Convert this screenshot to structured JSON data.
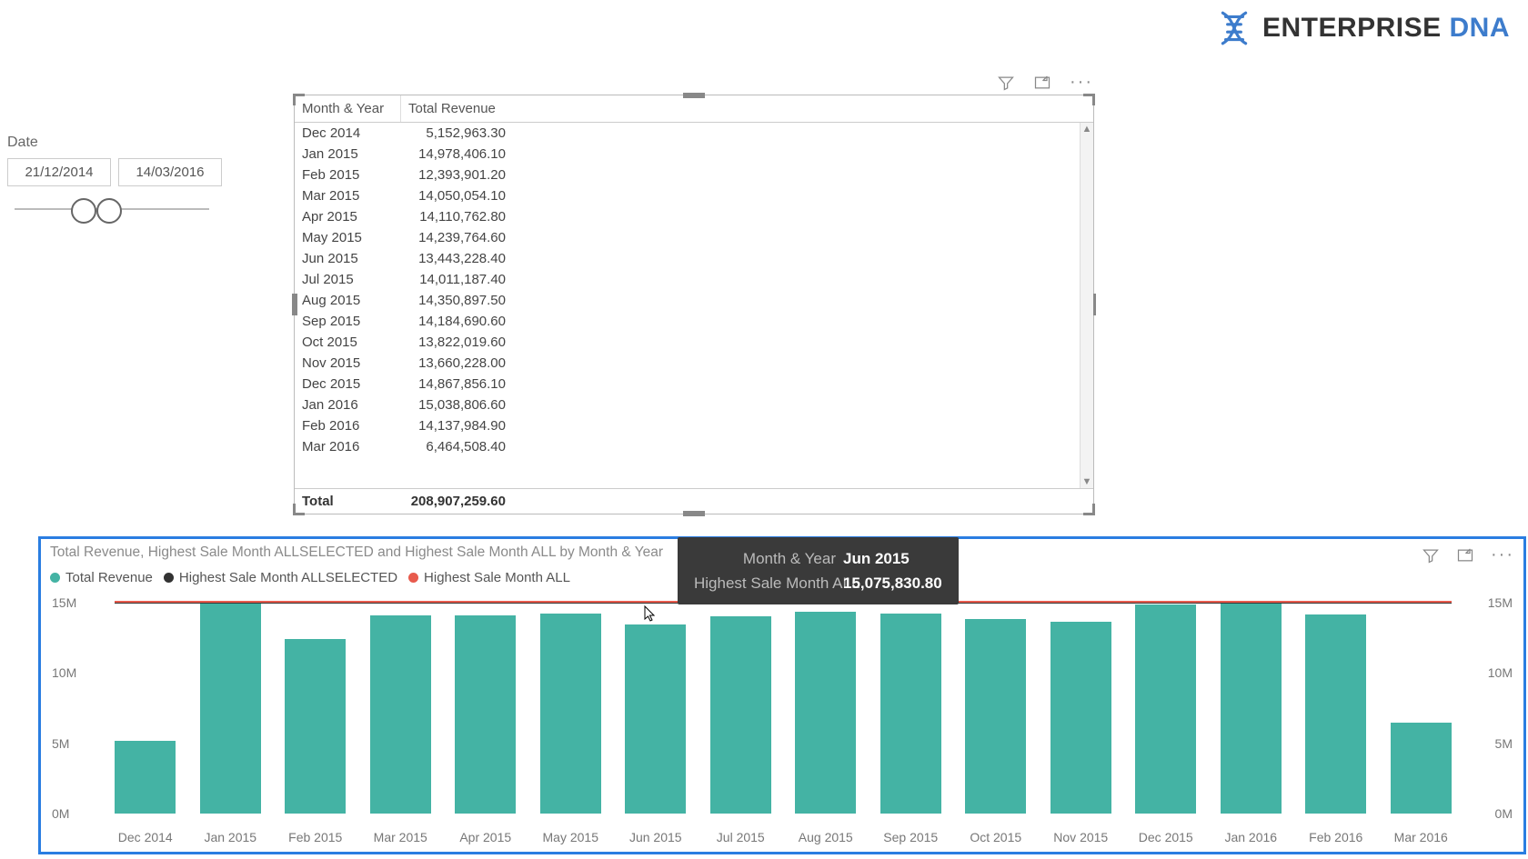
{
  "brand": {
    "name1": "ENTERPRISE",
    "name2": "DNA"
  },
  "slicer": {
    "title": "Date",
    "from": "21/12/2014",
    "to": "14/03/2016"
  },
  "table": {
    "headers": {
      "c1": "Month & Year",
      "c2": "Total Revenue"
    },
    "rows": [
      {
        "c1": "Dec 2014",
        "c2": "5,152,963.30"
      },
      {
        "c1": "Jan 2015",
        "c2": "14,978,406.10"
      },
      {
        "c1": "Feb 2015",
        "c2": "12,393,901.20"
      },
      {
        "c1": "Mar 2015",
        "c2": "14,050,054.10"
      },
      {
        "c1": "Apr 2015",
        "c2": "14,110,762.80"
      },
      {
        "c1": "May 2015",
        "c2": "14,239,764.60"
      },
      {
        "c1": "Jun 2015",
        "c2": "13,443,228.40"
      },
      {
        "c1": "Jul 2015",
        "c2": "14,011,187.40"
      },
      {
        "c1": "Aug 2015",
        "c2": "14,350,897.50"
      },
      {
        "c1": "Sep 2015",
        "c2": "14,184,690.60"
      },
      {
        "c1": "Oct 2015",
        "c2": "13,822,019.60"
      },
      {
        "c1": "Nov 2015",
        "c2": "13,660,228.00"
      },
      {
        "c1": "Dec 2015",
        "c2": "14,867,856.10"
      },
      {
        "c1": "Jan 2016",
        "c2": "15,038,806.60"
      },
      {
        "c1": "Feb 2016",
        "c2": "14,137,984.90"
      },
      {
        "c1": "Mar 2016",
        "c2": "6,464,508.40"
      }
    ],
    "total": {
      "label": "Total",
      "value": "208,907,259.60"
    }
  },
  "chart_data": {
    "type": "bar",
    "title": "Total Revenue, Highest Sale Month ALLSELECTED and Highest Sale Month ALL by Month & Year",
    "legend": [
      {
        "name": "Total Revenue",
        "color": "#44b3a4"
      },
      {
        "name": "Highest Sale Month ALLSELECTED",
        "color": "#333333"
      },
      {
        "name": "Highest Sale Month ALL",
        "color": "#e85b4d"
      }
    ],
    "categories": [
      "Dec 2014",
      "Jan 2015",
      "Feb 2015",
      "Mar 2015",
      "Apr 2015",
      "May 2015",
      "Jun 2015",
      "Jul 2015",
      "Aug 2015",
      "Sep 2015",
      "Oct 2015",
      "Nov 2015",
      "Dec 2015",
      "Jan 2016",
      "Feb 2016",
      "Mar 2016"
    ],
    "series": [
      {
        "name": "Total Revenue",
        "values": [
          5152963.3,
          14978406.1,
          12393901.2,
          14050054.1,
          14110762.8,
          14239764.6,
          13443228.4,
          14011187.4,
          14350897.5,
          14184690.6,
          13822019.6,
          13660228.0,
          14867856.1,
          15038806.6,
          14137984.9,
          6464508.4
        ]
      },
      {
        "name": "Highest Sale Month ALLSELECTED",
        "values": [
          15038806.6,
          15038806.6,
          15038806.6,
          15038806.6,
          15038806.6,
          15038806.6,
          15038806.6,
          15038806.6,
          15038806.6,
          15038806.6,
          15038806.6,
          15038806.6,
          15038806.6,
          15038806.6,
          15038806.6,
          15038806.6
        ]
      },
      {
        "name": "Highest Sale Month ALL",
        "values": [
          15075830.8,
          15075830.8,
          15075830.8,
          15075830.8,
          15075830.8,
          15075830.8,
          15075830.8,
          15075830.8,
          15075830.8,
          15075830.8,
          15075830.8,
          15075830.8,
          15075830.8,
          15075830.8,
          15075830.8,
          15075830.8
        ]
      }
    ],
    "ylim": [
      0,
      15500000
    ],
    "yticks": [
      0,
      5000000,
      10000000,
      15000000
    ],
    "ytick_labels": [
      "0M",
      "5M",
      "10M",
      "15M"
    ],
    "xlabel": "",
    "ylabel": ""
  },
  "tooltip": {
    "l1_label": "Month & Year",
    "l1_value": "Jun 2015",
    "l2_label": "Highest Sale Month ALL",
    "l2_value": "15,075,830.80"
  }
}
